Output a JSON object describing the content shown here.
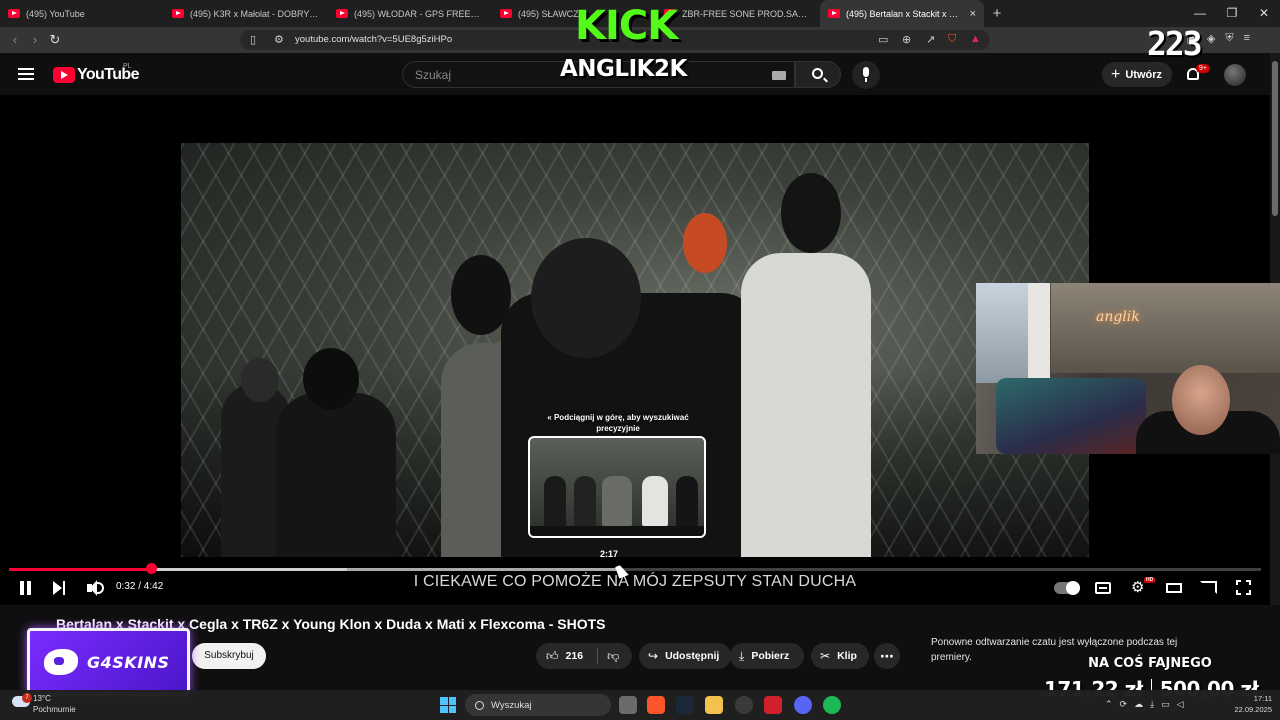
{
  "browser": {
    "tabs": [
      {
        "label": "(495) YouTube",
        "active": false
      },
      {
        "label": "(495) K3R x Małolat - DOBRY Z SERCA",
        "active": false
      },
      {
        "label": "(495) WŁODAR - GPS FREESTYLE (prod.",
        "active": false
      },
      {
        "label": "(495) SŁAWCZ",
        "active": false
      },
      {
        "label": "ZBR-FREE SONE PROD.SAMNU",
        "active": false
      },
      {
        "label": "(495) Bertalan x Stackit x Cegła",
        "active": true
      }
    ],
    "new_tab": "+",
    "url": "youtube.com/watch?v=5UE8g5ziHPo"
  },
  "youtube": {
    "logo": "YouTube",
    "region": "PL",
    "search_placeholder": "Szukaj",
    "create_label": "Utwórz",
    "notifications_badge": "9+"
  },
  "overlay": {
    "kick": "KICK",
    "streamer": "ANGLIK2K",
    "viewers": "223",
    "webcam_neon": "anglik",
    "g4skins": "G4SKINS",
    "donation_title": "NA COŚ FAJNEGO",
    "donation_current": "171,22 zł",
    "donation_goal": "500,00 zł"
  },
  "player": {
    "scrub_hint": "« Podciągnij w górę, aby wyszukiwać precyzyjnie",
    "preview_time": "2:17",
    "time": "0:32 / 4:42",
    "subtitle": "I CIEKAWE CO POMOŻE NA MÓJ ZEPSUTY STAN DUCHA",
    "played_fraction": 0.1135,
    "buffered_fraction": 0.27,
    "hover_fraction": 0.486,
    "hd_badge": "HD"
  },
  "video": {
    "title": "Bertalan x Stackit x Cegla x TR6Z x Young Klon x Duda x Mati x Flexcoma - SHOTS",
    "subscribe_label": "Subskrybuj",
    "likes": "216",
    "share_label": "Udostępnij",
    "download_label": "Pobierz",
    "clip_label": "Klip",
    "more_label": "⋯"
  },
  "chat": {
    "disabled_note": "Ponowne odtwarzanie czatu jest wyłączone podczas tej premiery."
  },
  "taskbar": {
    "weather_temp": "13°C",
    "weather_condition": "Pochmurnie",
    "weather_badge": "7",
    "search_label": "Wyszukaj",
    "time": "17:11",
    "date": "22.09.2025"
  },
  "colors": {
    "accent_red": "#ff0033",
    "kick_green": "#53fc18",
    "g4_purple": "#7a2cff"
  }
}
